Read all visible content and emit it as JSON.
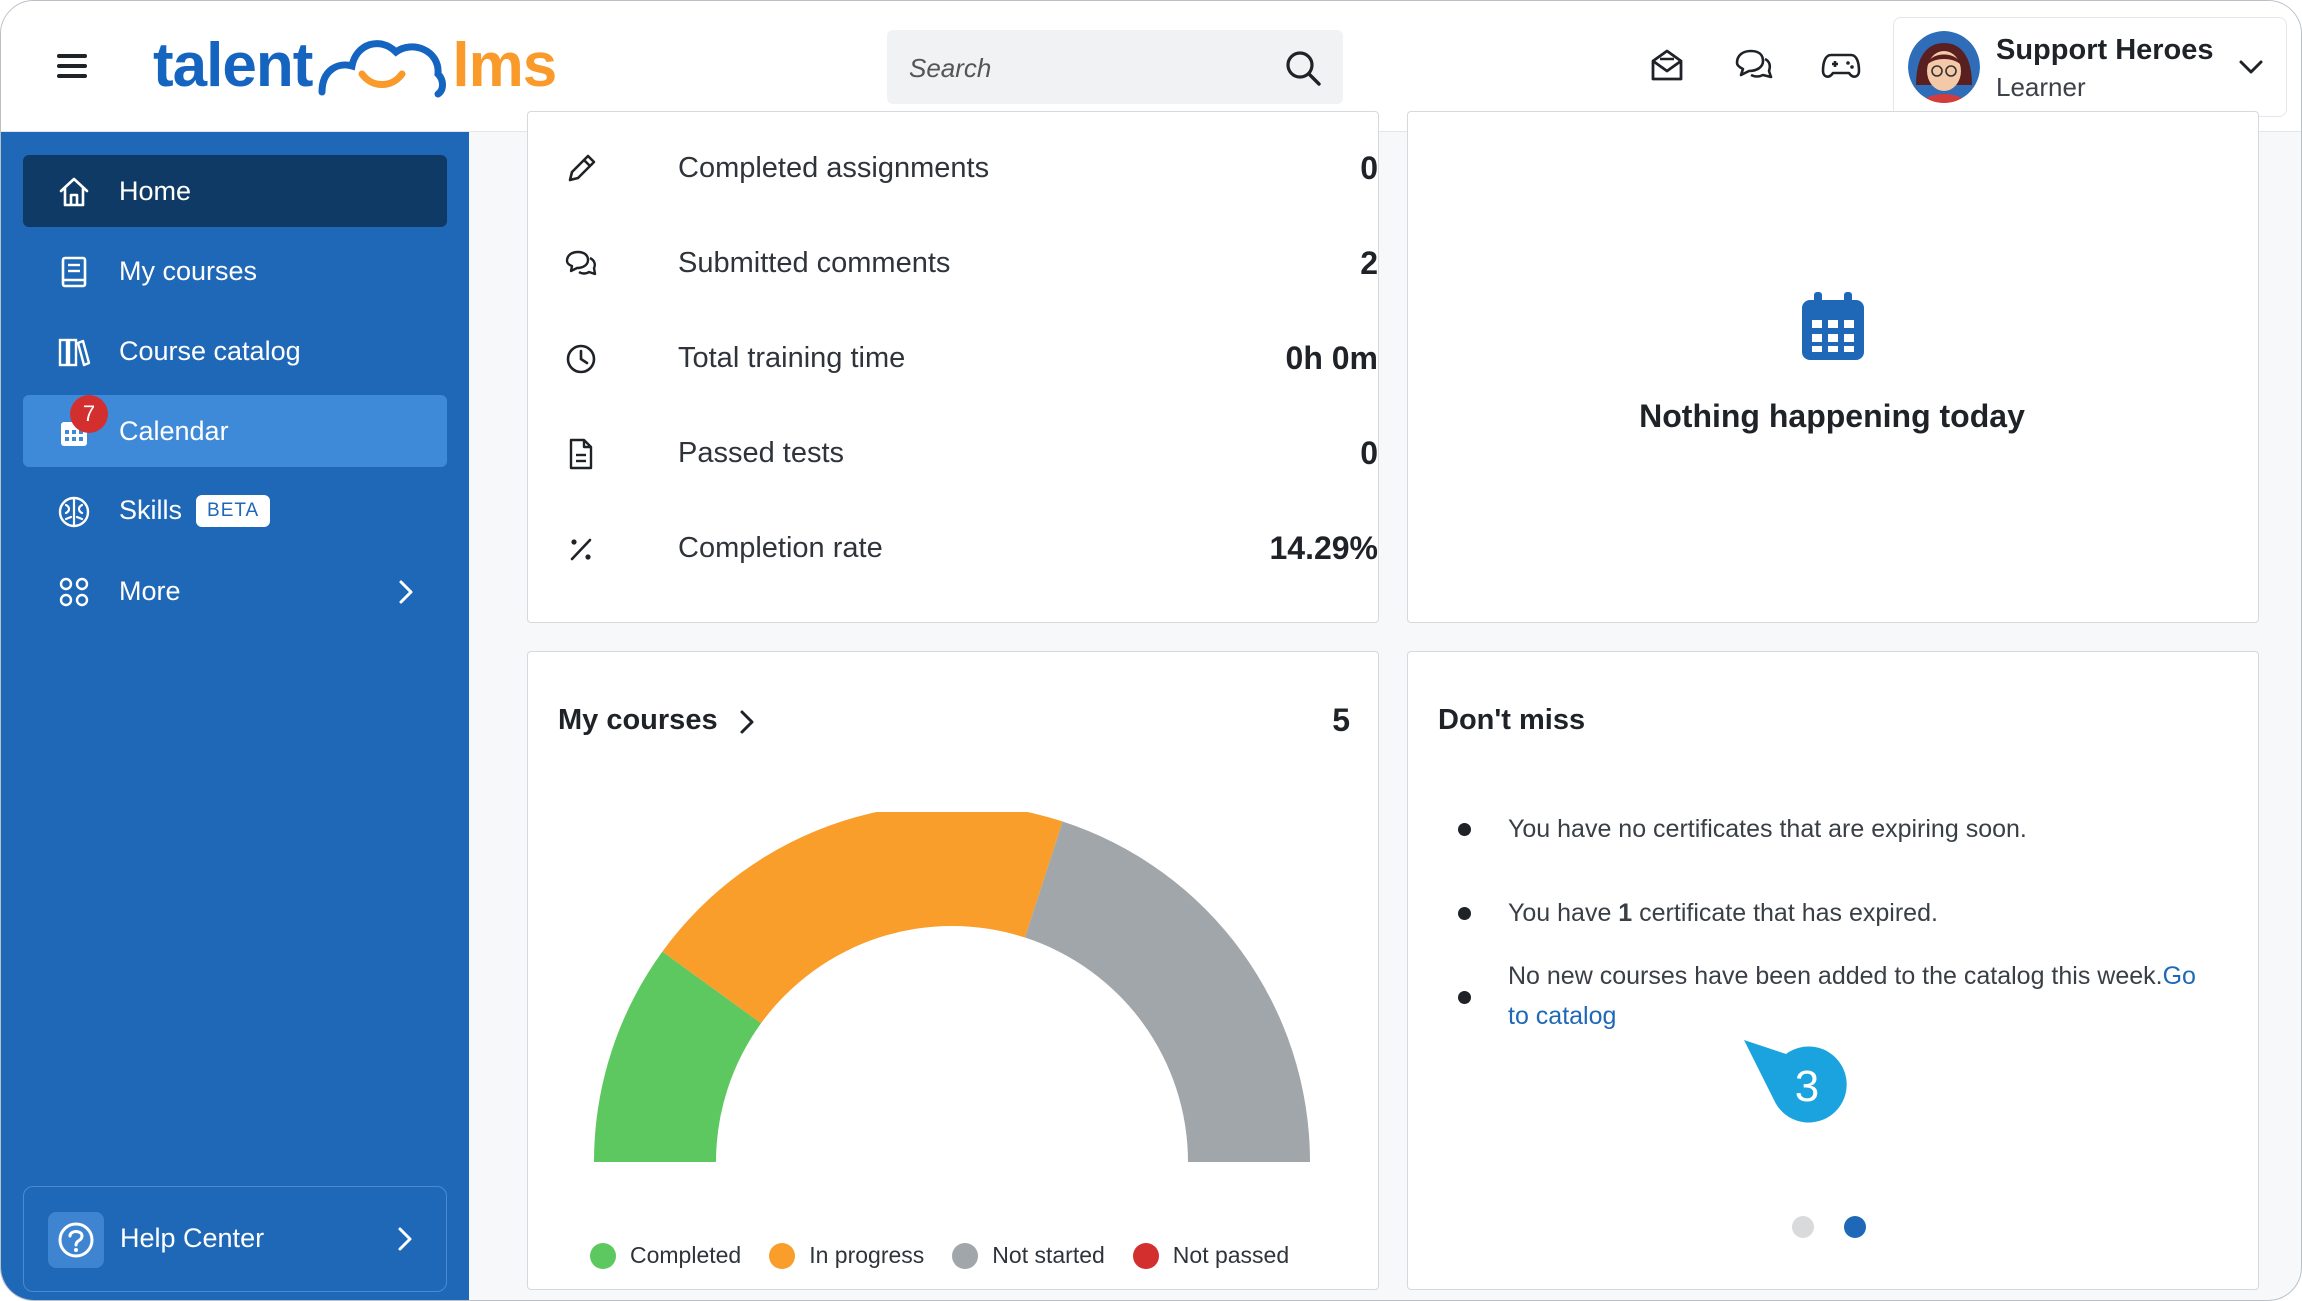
{
  "header": {
    "logo": {
      "part1": "talent",
      "part2": "lms"
    },
    "search": {
      "placeholder": "Search"
    },
    "profile": {
      "name": "Support Heroes",
      "role": "Learner"
    }
  },
  "sidebar": {
    "items": [
      {
        "label": "Home",
        "icon": "home-icon"
      },
      {
        "label": "My courses",
        "icon": "book-icon"
      },
      {
        "label": "Course catalog",
        "icon": "library-icon"
      },
      {
        "label": "Calendar",
        "icon": "calendar-icon",
        "badge": "7"
      },
      {
        "label": "Skills",
        "icon": "brain-icon",
        "tag": "BETA"
      },
      {
        "label": "More",
        "icon": "grid-icon"
      }
    ],
    "help": {
      "label": "Help Center"
    }
  },
  "stats": [
    {
      "label": "Completed assignments",
      "value": "0",
      "icon": "pencil-icon"
    },
    {
      "label": "Submitted comments",
      "value": "2",
      "icon": "comments-icon"
    },
    {
      "label": "Total training time",
      "value": "0h 0m",
      "icon": "clock-icon"
    },
    {
      "label": "Passed tests",
      "value": "0",
      "icon": "document-icon"
    },
    {
      "label": "Completion rate",
      "value": "14.29%",
      "icon": "percent-icon"
    }
  ],
  "calendar_card": {
    "message": "Nothing happening today"
  },
  "courses_card": {
    "title": "My courses",
    "count": "5"
  },
  "chart_data": {
    "type": "pie",
    "subtype": "semi-donut",
    "categories": [
      "Completed",
      "In progress",
      "Not started",
      "Not passed"
    ],
    "values": [
      1,
      2,
      2,
      0
    ],
    "colors": [
      "#5cc85f",
      "#f99d2b",
      "#a0a6aa",
      "#d32f2f"
    ],
    "legend": "bottom"
  },
  "dont_miss": {
    "title": "Don't miss",
    "item1": "You have no certificates that are expiring soon.",
    "item2_pre": "You have ",
    "item2_bold": "1",
    "item2_post": " certificate that has expired.",
    "item3": "No new courses have been added to the catalog this week.",
    "item3_link": "Go to catalog"
  },
  "callout": {
    "number": "3",
    "color": "#1aa3de"
  },
  "pager": {
    "active_index": 1,
    "count": 2
  },
  "colors": {
    "brand": "#1e68b7",
    "nav_active": "#103a66",
    "nav_highlight": "#3f8ad8",
    "logo_orange": "#f99a2a"
  }
}
